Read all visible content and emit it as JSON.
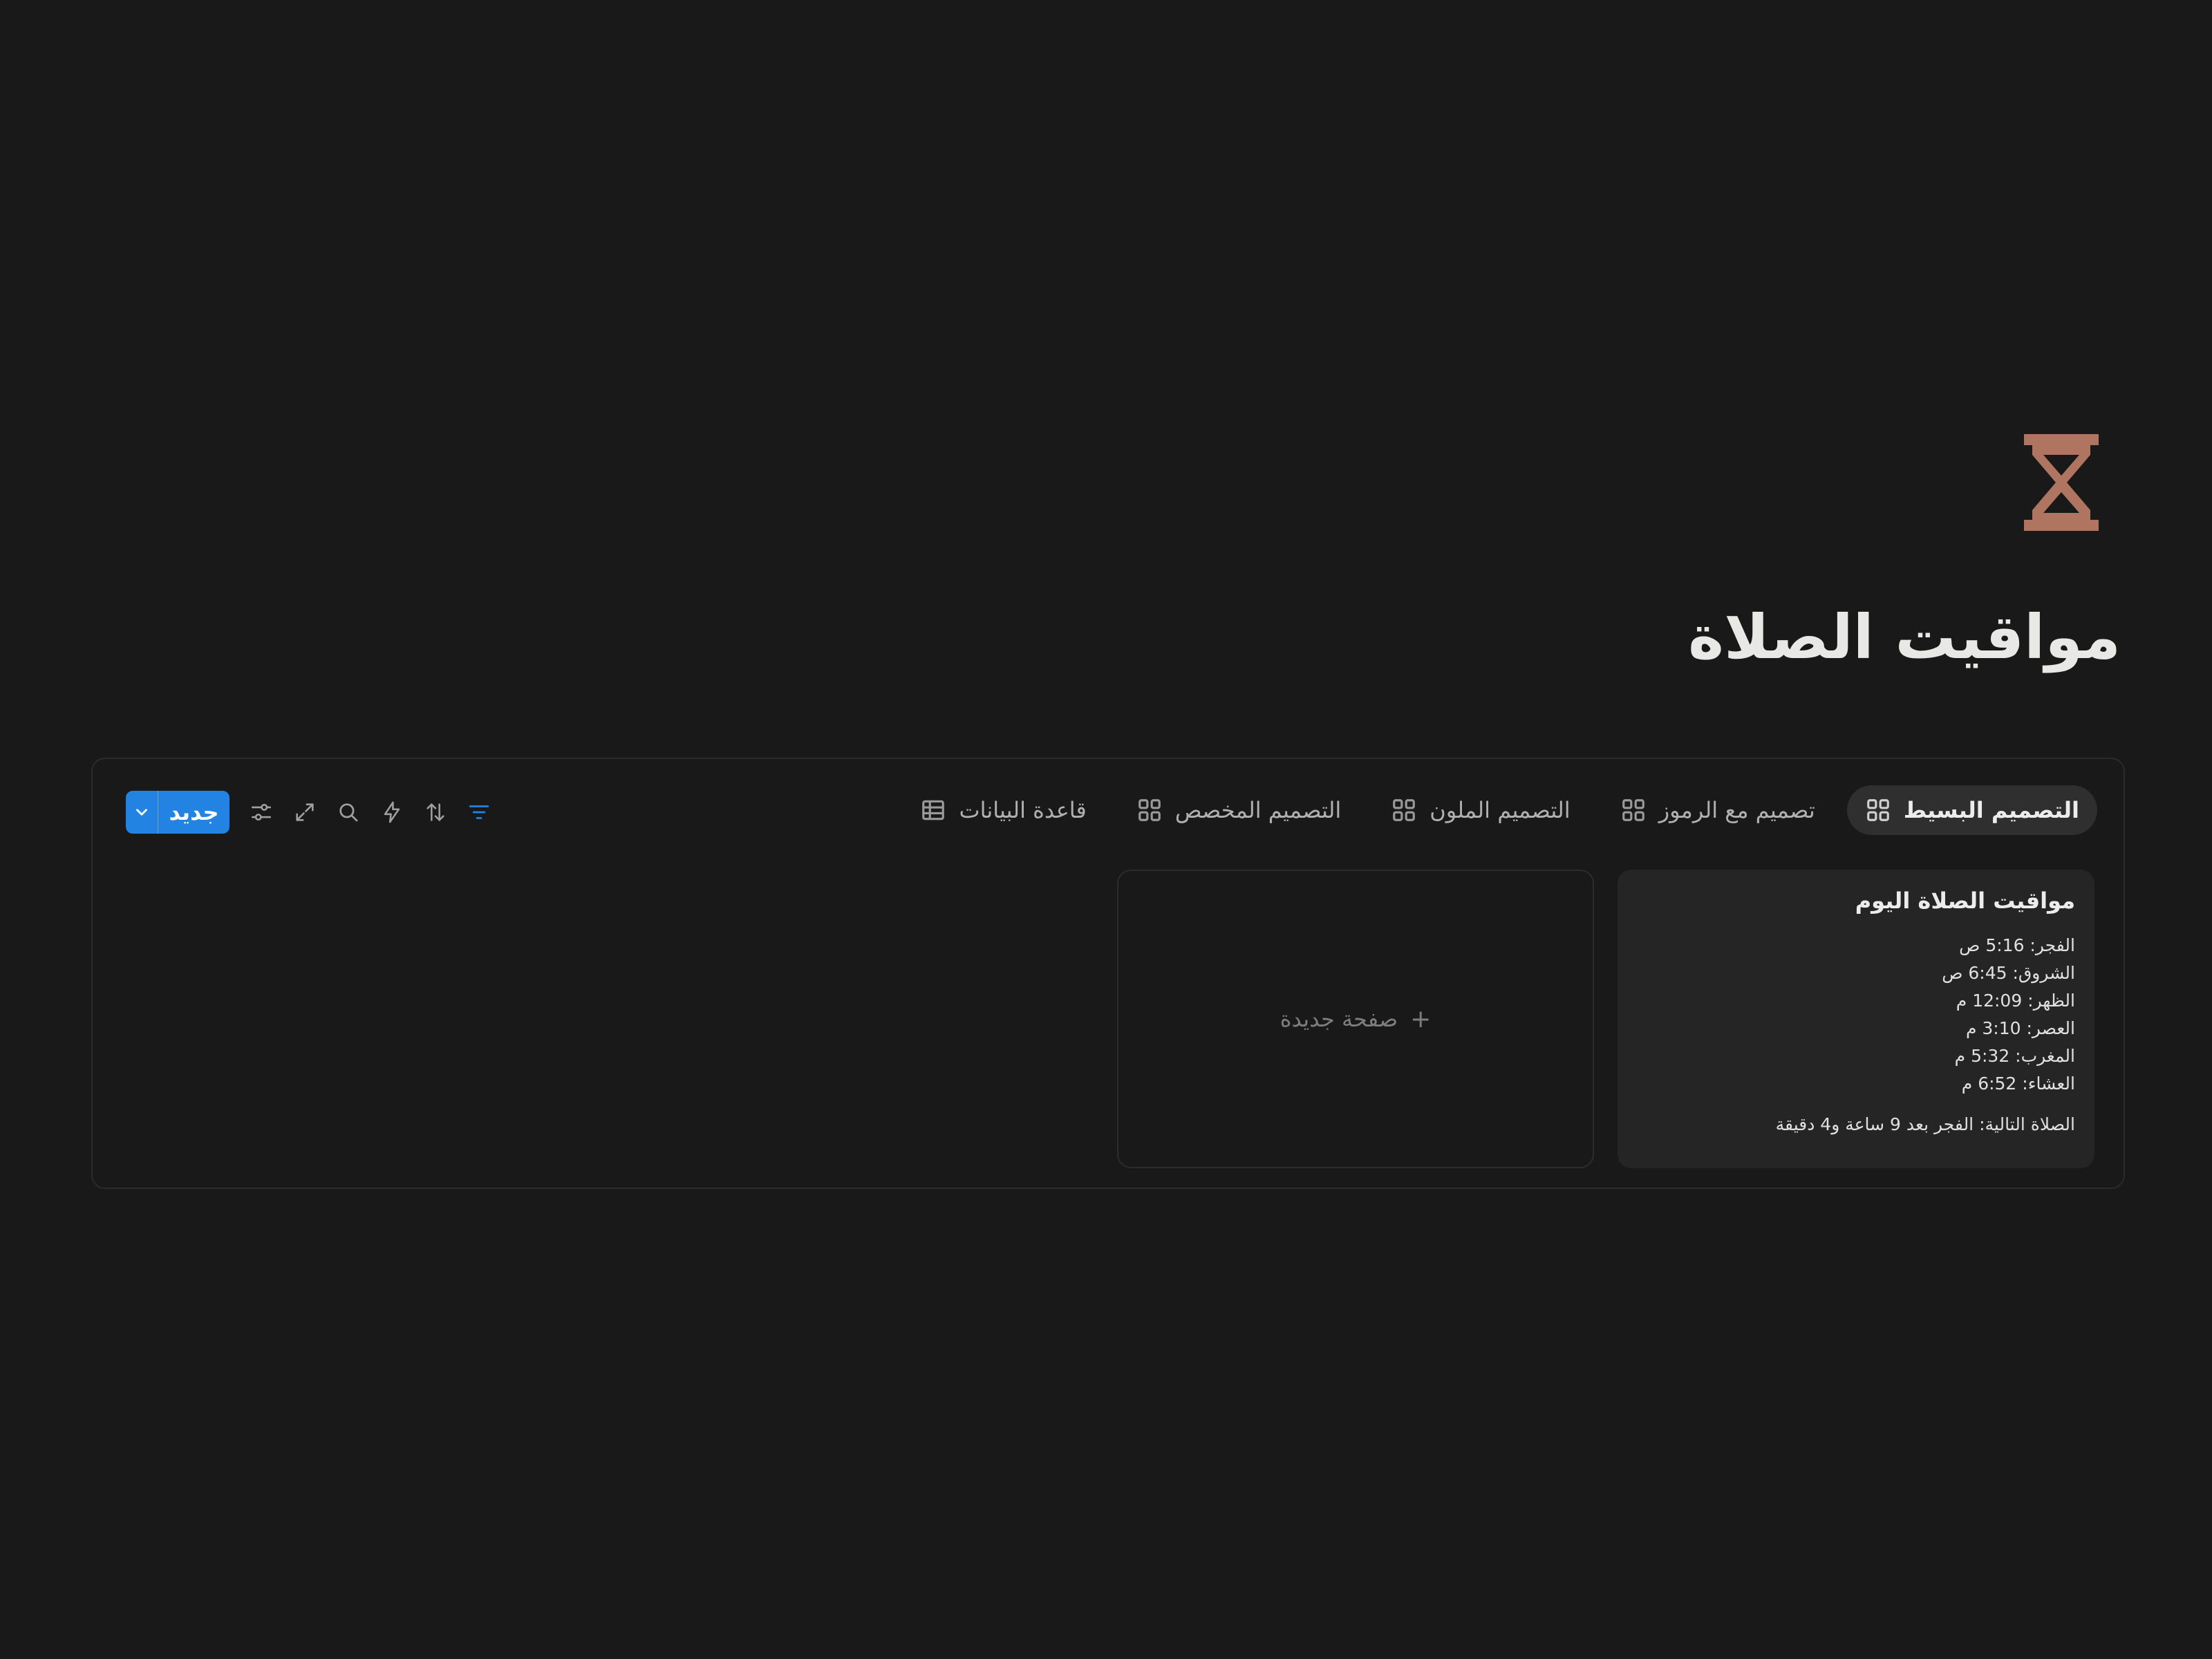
{
  "page": {
    "icon": "hourglass-icon",
    "title": "مواقيت الصلاة"
  },
  "colors": {
    "background": "#191919",
    "icon": "#b07560",
    "accent": "#2383e2",
    "card": "#252525"
  },
  "tabs": [
    {
      "label": "التصميم البسيط",
      "icon": "gallery-icon",
      "active": true
    },
    {
      "label": "تصميم مع الرموز",
      "icon": "gallery-icon",
      "active": false
    },
    {
      "label": "التصميم الملون",
      "icon": "gallery-icon",
      "active": false
    },
    {
      "label": "التصميم المخصص",
      "icon": "gallery-icon",
      "active": false
    },
    {
      "label": "قاعدة البيانات",
      "icon": "table-icon",
      "active": false
    }
  ],
  "toolbar": {
    "new_label": "جديد",
    "icons": [
      "filter-icon",
      "sort-icon",
      "automation-icon",
      "search-icon",
      "expand-icon",
      "settings-icon",
      "chevron-down-icon"
    ]
  },
  "card": {
    "title": "مواقيت الصلاة اليوم",
    "times": [
      "الفجر: 5:16 ص",
      "الشروق: 6:45 ص",
      "الظهر: 12:09 م",
      "العصر: 3:10 م",
      "المغرب: 5:32 م",
      "العشاء: 6:52 م"
    ],
    "next": "الصلاة التالية: الفجر بعد 9 ساعة و4 دقيقة"
  },
  "new_page": {
    "label": "صفحة جديدة",
    "plus": "+"
  }
}
